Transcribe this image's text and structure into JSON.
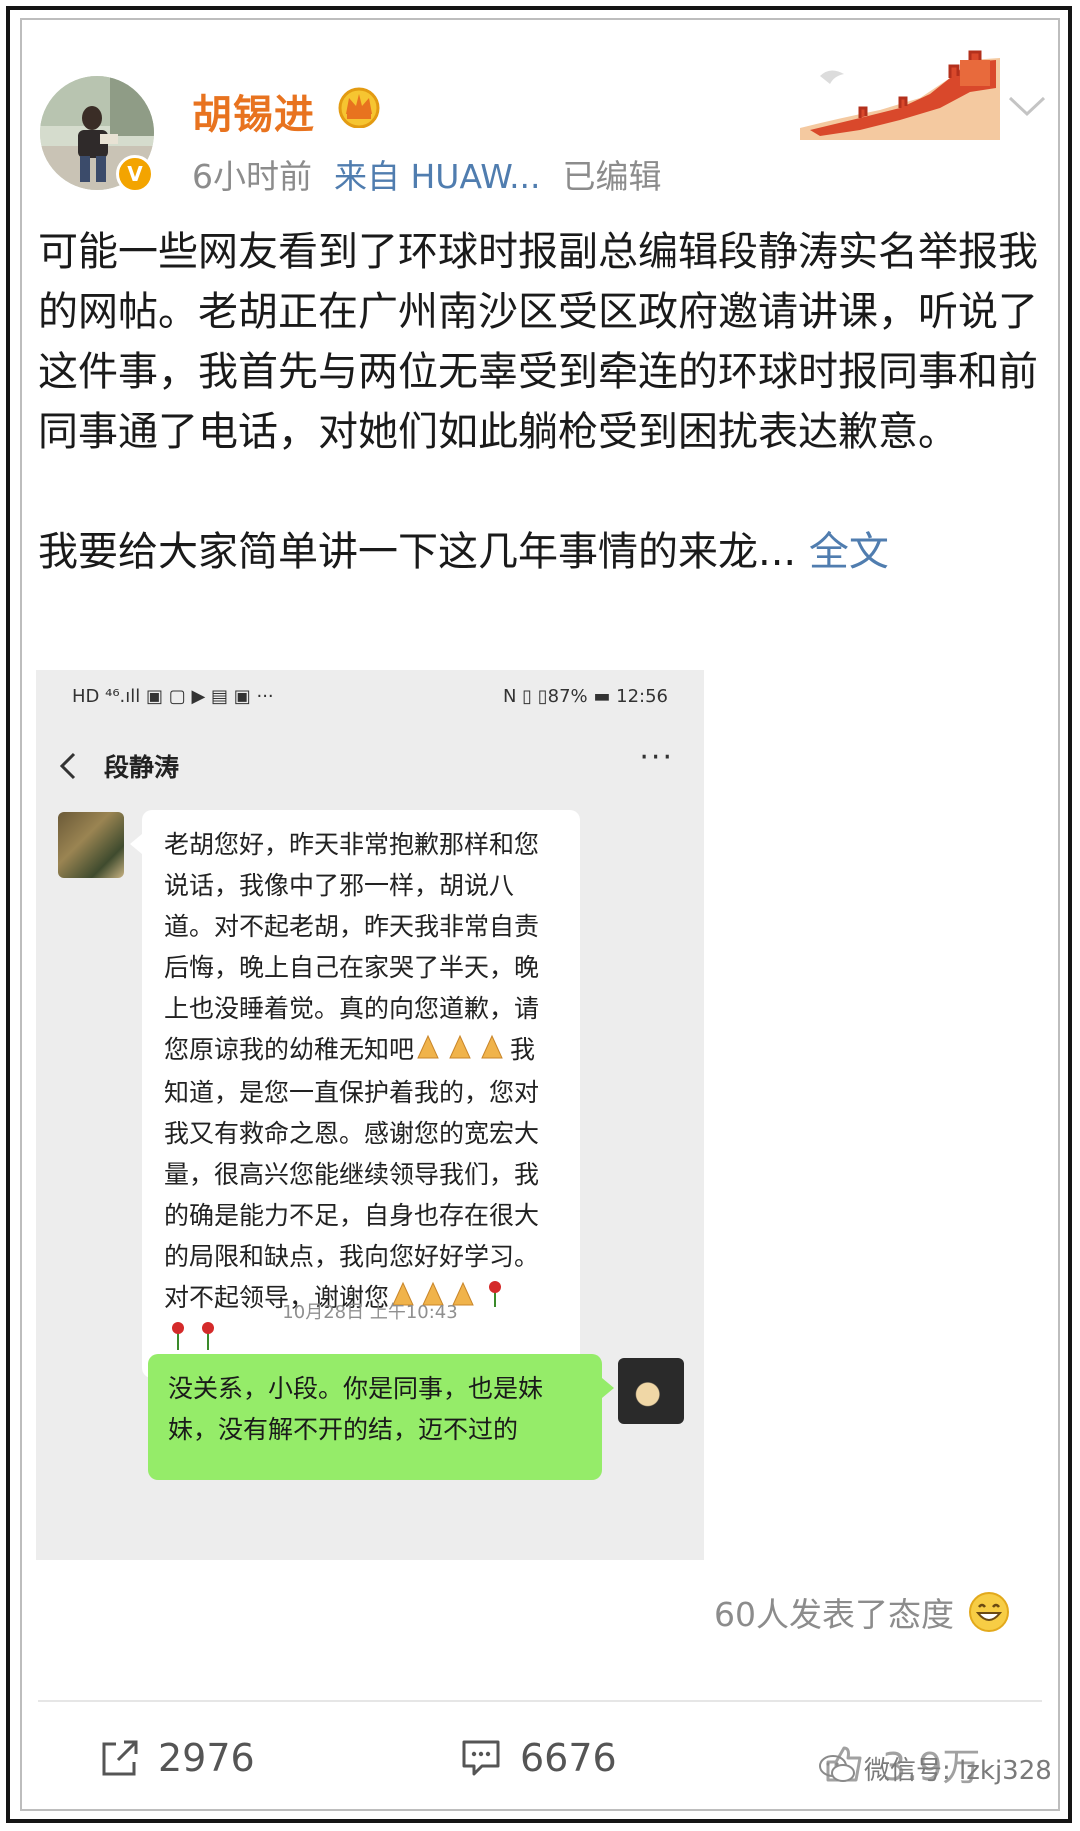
{
  "author": {
    "name": "胡锡进",
    "time": "6小时前",
    "source": "来自 HUAW...",
    "edited": "已编辑"
  },
  "post": {
    "paragraph1": "可能一些网友看到了环球时报副总编辑段静涛实名举报我的网帖。老胡正在广州南沙区受区政府邀请讲课，听说了这件事，我首先与两位无辜受到牵连的环球时报同事和前同事通了电话，对她们如此躺枪受到困扰表达歉意。",
    "paragraph2": "我要给大家简单讲一下这几年事情的来龙...",
    "full_text_link": "全文"
  },
  "screenshot": {
    "status_left": "HD ⁴⁶.ıll",
    "status_battery": "87%",
    "status_time": "12:56",
    "chat_title": "段静涛",
    "more": "···",
    "message_in_1": "老胡您好，昨天非常抱歉那样和您说话，我像中了邪一样，胡说八道。对不起老胡，昨天我非常自责后悔，晚上自己在家哭了半天，晚上也没睡着觉。真的向您道歉，请您原谅我的幼稚无知吧",
    "message_in_2": "我知道，是您一直保护着我的，您对我又有救命之恩。感谢您的宽宏大量，很高兴您能继续领导我们，我的确是能力不足，自身也存在很大的局限和缺点，我向您好好学习。对不起领导，谢谢您",
    "timestamp": "10月28日 上午10:43",
    "message_out": "没关系，小段。你是同事，也是妹妹，没有解不开的结，迈不过的"
  },
  "reactions": {
    "text": "60人发表了态度"
  },
  "actions": {
    "share_count": "2976",
    "comment_count": "6676",
    "like_count": "3.9万"
  },
  "watermark": "微信号: lzkj328",
  "colors": {
    "username": "#e8731f",
    "link": "#507daf",
    "meta": "#8c8c8c",
    "bubble_out": "#95ec69",
    "verified": "#f3a400"
  }
}
